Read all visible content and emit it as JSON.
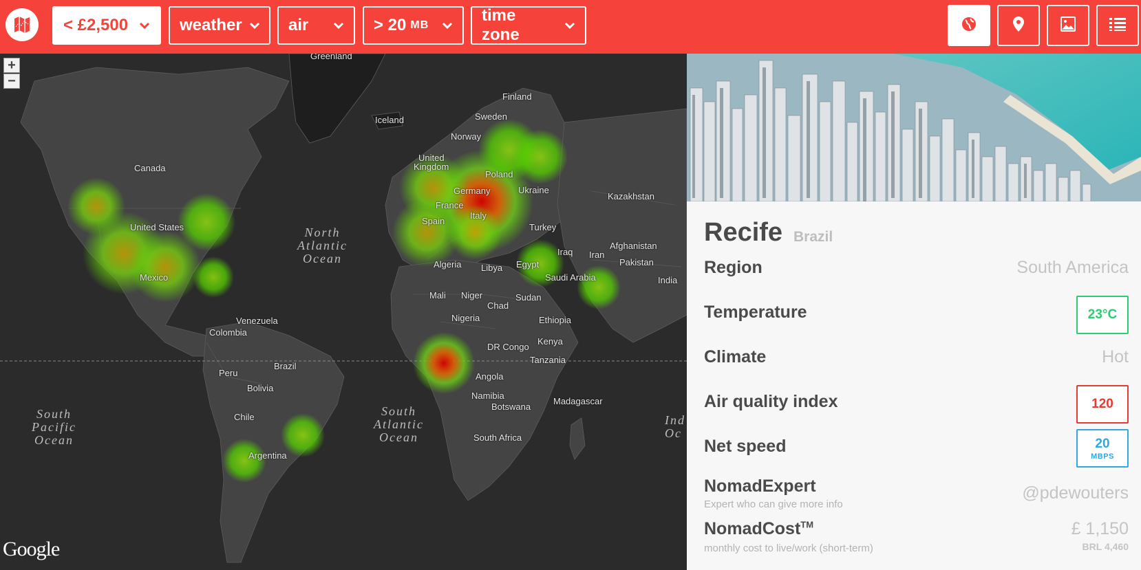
{
  "toolbar": {
    "filters": [
      {
        "label": "< £2,500",
        "sub": ""
      },
      {
        "label": "weather",
        "sub": ""
      },
      {
        "label": "air",
        "sub": ""
      },
      {
        "label": "> 20",
        "sub": "MB"
      },
      {
        "label": "time zone",
        "sub": ""
      }
    ],
    "view_buttons": [
      "globe-icon",
      "map-pin-icon",
      "image-icon",
      "list-icon"
    ],
    "accent": "#f5423a"
  },
  "map": {
    "zoom_in": "+",
    "zoom_out": "−",
    "attribution": "Google",
    "labels": {
      "greenland": "Greenland",
      "iceland": "Iceland",
      "finland": "Finland",
      "sweden": "Sweden",
      "norway": "Norway",
      "uk1": "United",
      "uk2": "Kingdom",
      "canada": "Canada",
      "poland": "Poland",
      "germany": "Germany",
      "ukraine": "Ukraine",
      "kazakhstan": "Kazakhstan",
      "france": "France",
      "spain": "Spain",
      "italy": "Italy",
      "turkey": "Turkey",
      "united_states": "United States",
      "afghanistan": "Afghanistan",
      "iraq": "Iraq",
      "iran": "Iran",
      "pakistan": "Pakistan",
      "algeria": "Algeria",
      "libya": "Libya",
      "egypt": "Egypt",
      "mexico": "Mexico",
      "saudi_arabia": "Saudi Arabia",
      "india": "India",
      "mali": "Mali",
      "niger": "Niger",
      "chad": "Chad",
      "sudan": "Sudan",
      "venezuela": "Venezuela",
      "nigeria": "Nigeria",
      "ethiopia": "Ethiopia",
      "colombia": "Colombia",
      "kenya": "Kenya",
      "dr_congo": "DR Congo",
      "tanzania": "Tanzania",
      "brazil": "Brazil",
      "peru": "Peru",
      "angola": "Angola",
      "bolivia": "Bolivia",
      "namibia": "Namibia",
      "madagascar": "Madagascar",
      "botswana": "Botswana",
      "chile": "Chile",
      "south_africa": "South Africa",
      "argentina": "Argentina"
    },
    "oceans": {
      "north_atlantic": [
        "North",
        "Atlantic",
        "Ocean"
      ],
      "south_pacific": [
        "South",
        "Pacific",
        "Ocean"
      ],
      "south_atlantic": [
        "South",
        "Atlantic",
        "Ocean"
      ],
      "indian": [
        "Ind",
        "Oc"
      ]
    }
  },
  "city": {
    "name": "Recife",
    "country": "Brazil",
    "rows": {
      "region": {
        "label": "Region",
        "value": "South America"
      },
      "temperature": {
        "label": "Temperature",
        "value": "23°C",
        "color": "#2ecc71"
      },
      "climate": {
        "label": "Climate",
        "value": "Hot"
      },
      "air_quality": {
        "label": "Air quality index",
        "value": "120",
        "color": "#e83a34"
      },
      "net_speed": {
        "label": "Net speed",
        "value": "20",
        "unit": "MBPS",
        "color": "#2fa8e0"
      },
      "nomad_expert": {
        "label": "NomadExpert",
        "sub": "Expert who can give more info",
        "value": "@pdewouters"
      },
      "nomad_cost": {
        "label": "NomadCost",
        "tm": "TM",
        "sub": "monthly cost to live/work (short-term)",
        "value": "£ 1,150",
        "value2": "BRL 4,460"
      }
    }
  }
}
